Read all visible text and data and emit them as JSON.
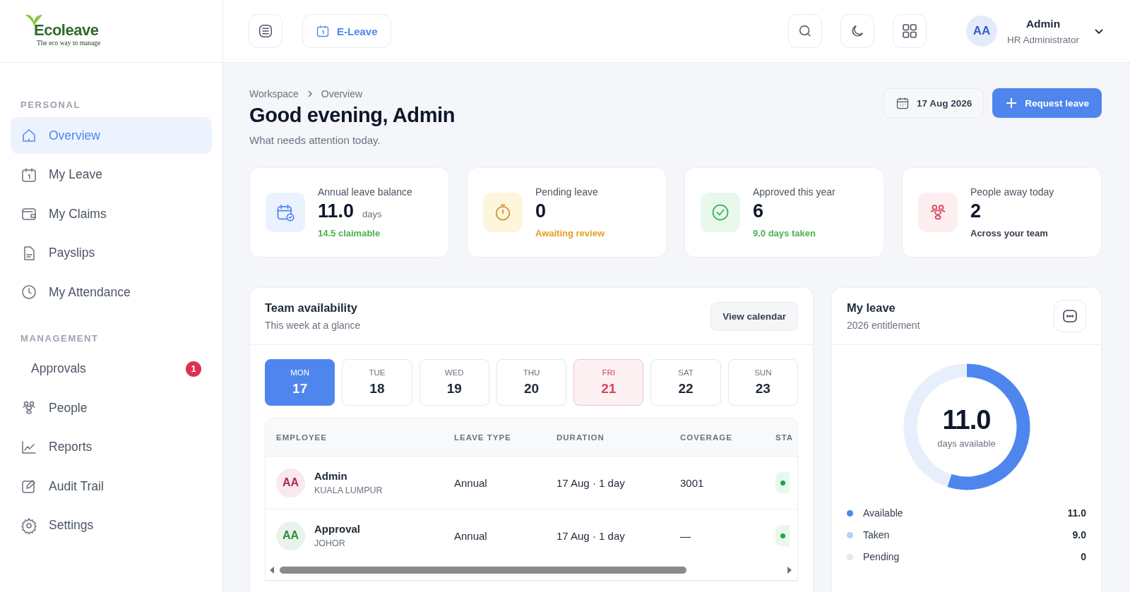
{
  "logo": {
    "wordmark": "Ecoleave",
    "tagline": "The eco way to manage"
  },
  "topbar": {
    "module_button": "E-Leave",
    "user": {
      "initials": "AA",
      "name": "Admin",
      "role": "HR Administrator"
    }
  },
  "sidebar": {
    "sections": [
      {
        "label": "PERSONAL",
        "items": [
          {
            "label": "Overview",
            "selected": true
          },
          {
            "label": "My Leave",
            "selected": false
          },
          {
            "label": "My Claims",
            "selected": false
          },
          {
            "label": "Payslips",
            "selected": false
          },
          {
            "label": "My Attendance",
            "selected": false
          }
        ]
      },
      {
        "label": "MANAGEMENT",
        "items": [
          {
            "label": "Approvals",
            "selected": false,
            "badge": "1"
          },
          {
            "label": "People",
            "selected": false
          },
          {
            "label": "Reports",
            "selected": false
          },
          {
            "label": "Audit Trail",
            "selected": false
          },
          {
            "label": "Settings",
            "selected": false
          }
        ]
      }
    ]
  },
  "breadcrumb": [
    "Workspace",
    "Overview"
  ],
  "heading": {
    "title": "Good evening, Admin",
    "subtitle": "What needs attention today."
  },
  "date_button": "17 Aug 2026",
  "primary_button": "Request leave",
  "stats": [
    {
      "label": "Annual leave balance",
      "value": "11.0",
      "unit": "days",
      "note": "14.5 claimable",
      "color": "#4caf50"
    },
    {
      "label": "Pending leave",
      "value": "0",
      "note": "Awaiting review",
      "color": "#e0a020"
    },
    {
      "label": "Approved this year",
      "value": "6",
      "note": "9.0 days taken",
      "color": "#4caf50"
    },
    {
      "label": "People away today",
      "value": "2",
      "note": "Across your team",
      "color": "#374151"
    }
  ],
  "team": {
    "title": "Team availability",
    "subtitle": "This week at a glance",
    "button": "View calendar",
    "days": [
      {
        "day": "MON",
        "date": "17",
        "selected": true,
        "highlighted": false
      },
      {
        "day": "TUE",
        "date": "18",
        "selected": false,
        "highlighted": false
      },
      {
        "day": "WED",
        "date": "19",
        "selected": false,
        "highlighted": false
      },
      {
        "day": "THU",
        "date": "20",
        "selected": false,
        "highlighted": false
      },
      {
        "day": "FRI",
        "date": "21",
        "selected": false,
        "highlighted": true
      },
      {
        "day": "SAT",
        "date": "22",
        "selected": false,
        "highlighted": false
      },
      {
        "day": "SUN",
        "date": "23",
        "selected": false,
        "highlighted": false
      }
    ],
    "table": {
      "columns": [
        "EMPLOYEE",
        "LEAVE TYPE",
        "DURATION",
        "COVERAGE",
        "STA"
      ],
      "rows": [
        {
          "initials": "AA",
          "color": "#b0285a",
          "name": "Admin",
          "location": "KUALA LUMPUR",
          "leave_type": "Annual",
          "duration": "17 Aug · 1 day",
          "coverage": "3001"
        },
        {
          "initials": "AA",
          "color": "#2e8b3e",
          "name": "Approval",
          "location": "JOHOR",
          "leave_type": "Annual",
          "duration": "17 Aug · 1 day",
          "coverage": "—"
        }
      ]
    }
  },
  "my_leave": {
    "title": "My leave",
    "subtitle": "2026 entitlement",
    "center_value": "11.0",
    "center_label": "days available",
    "legend": [
      {
        "label": "Available",
        "value": "11.0",
        "color": "#4f86ee"
      },
      {
        "label": "Taken",
        "value": "9.0",
        "color": "#b8cdf7"
      },
      {
        "label": "Pending",
        "value": "0",
        "color": "#e5e7eb"
      }
    ]
  }
}
